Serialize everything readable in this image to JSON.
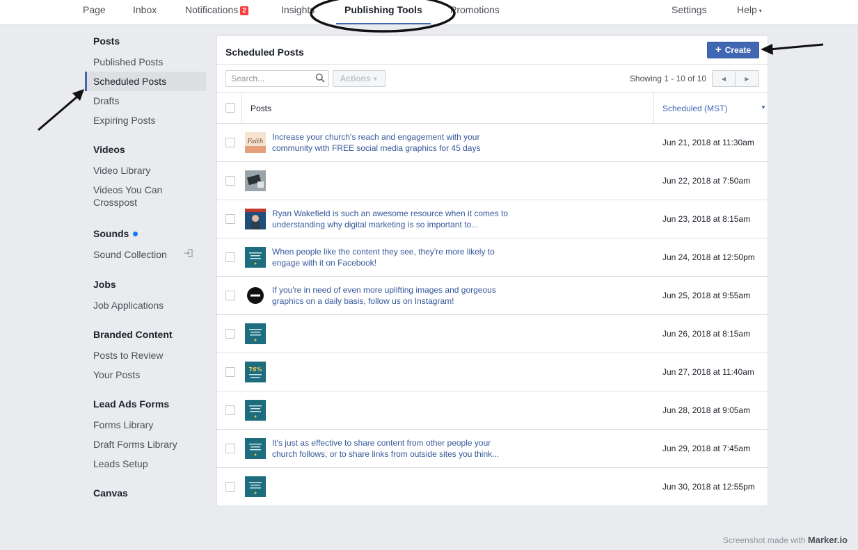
{
  "topnav": {
    "tabs": [
      {
        "label": "Page"
      },
      {
        "label": "Inbox"
      },
      {
        "label": "Notifications",
        "badge": "2"
      },
      {
        "label": "Insights"
      },
      {
        "label": "Publishing Tools",
        "active": true
      },
      {
        "label": "Promotions"
      }
    ],
    "settings": "Settings",
    "help": "Help",
    "help_caret": "▾"
  },
  "sidebar": {
    "sections": [
      {
        "title": "Posts",
        "items": [
          "Published Posts",
          "Scheduled Posts",
          "Drafts",
          "Expiring Posts"
        ],
        "active": "Scheduled Posts"
      },
      {
        "title": "Videos",
        "items": [
          "Video Library",
          "Videos You Can Crosspost"
        ]
      },
      {
        "title": "Sounds",
        "items": [
          "Sound Collection"
        ]
      },
      {
        "title": "Jobs",
        "items": [
          "Job Applications"
        ]
      },
      {
        "title": "Branded Content",
        "items": [
          "Posts to Review",
          "Your Posts"
        ]
      },
      {
        "title": "Lead Ads Forms",
        "items": [
          "Forms Library",
          "Draft Forms Library",
          "Leads Setup"
        ]
      },
      {
        "title": "Canvas",
        "items": []
      }
    ]
  },
  "main": {
    "title": "Scheduled Posts",
    "create_label": "Create",
    "search_placeholder": "Search...",
    "actions_label": "Actions",
    "showing": "Showing 1 - 10 of 10",
    "columns": {
      "posts": "Posts",
      "scheduled": "Scheduled (MST)"
    },
    "rows": [
      {
        "text": "Increase your church's reach and engagement with your community with FREE social media graphics for 45 days",
        "date": "Jun 21, 2018 at 11:30am",
        "thumb": "faith",
        "thumb_text": "Faith"
      },
      {
        "text": "",
        "date": "Jun 22, 2018 at 7:50am",
        "thumb": "desk",
        "thumb_text": ""
      },
      {
        "text": "Ryan Wakefield is such an awesome resource when it comes to understanding why digital marketing is so important to...",
        "date": "Jun 23, 2018 at 8:15am",
        "thumb": "person",
        "thumb_text": ""
      },
      {
        "text": "When people like the content they see, they're more likely to engage with it on Facebook!",
        "date": "Jun 24, 2018 at 12:50pm",
        "thumb": "teal",
        "thumb_text": ""
      },
      {
        "text": "If you're in need of even more uplifting images and gorgeous graphics on a daily basis, follow us on Instagram!",
        "date": "Jun 25, 2018 at 9:55am",
        "thumb": "logo",
        "thumb_text": ""
      },
      {
        "text": "",
        "date": "Jun 26, 2018 at 8:15am",
        "thumb": "teal",
        "thumb_text": ""
      },
      {
        "text": "",
        "date": "Jun 27, 2018 at 11:40am",
        "thumb": "teal76",
        "thumb_text": "76%"
      },
      {
        "text": "",
        "date": "Jun 28, 2018 at 9:05am",
        "thumb": "teal",
        "thumb_text": ""
      },
      {
        "text": "It's just as effective to share content from other people your church follows, or to share links from outside sites you think...",
        "date": "Jun 29, 2018 at 7:45am",
        "thumb": "teal",
        "thumb_text": ""
      },
      {
        "text": "",
        "date": "Jun 30, 2018 at 12:55pm",
        "thumb": "teal",
        "thumb_text": ""
      }
    ]
  },
  "footer": {
    "credit": "Screenshot made with",
    "brand": "Marker.io"
  },
  "colors": {
    "accent": "#4267b2",
    "badge": "#fa3e3e",
    "link": "#365899",
    "teal": "#1d6d7f"
  }
}
